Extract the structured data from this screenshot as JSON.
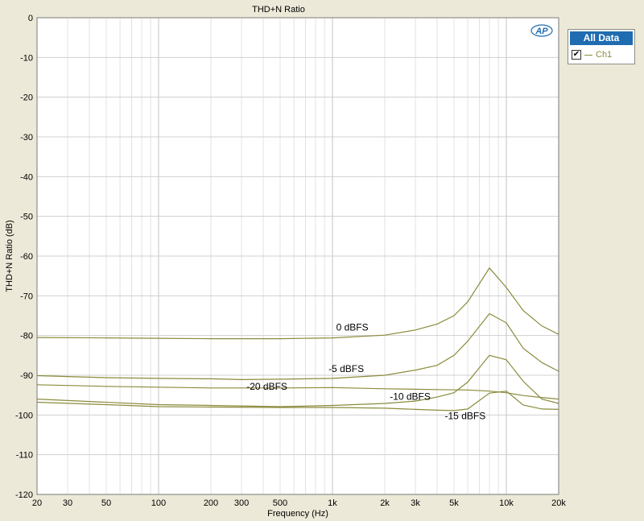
{
  "chart_data": {
    "type": "line",
    "title": "THD+N Ratio",
    "xlabel": "Frequency (Hz)",
    "ylabel": "THD+N Ratio (dB)",
    "xscale": "log",
    "xlim": [
      20,
      20000
    ],
    "ylim": [
      -120,
      0
    ],
    "xticks": [
      20,
      30,
      50,
      100,
      200,
      300,
      500,
      1000,
      2000,
      3000,
      5000,
      10000,
      20000
    ],
    "xtick_labels": [
      "20",
      "30",
      "50",
      "100",
      "200",
      "300",
      "500",
      "1k",
      "2k",
      "3k",
      "5k",
      "10k",
      "20k"
    ],
    "yticks": [
      0,
      -10,
      -20,
      -30,
      -40,
      -50,
      -60,
      -70,
      -80,
      -90,
      -100,
      -110,
      -120
    ],
    "grid": true,
    "series_color": "#8b8b3c",
    "series": [
      {
        "label": "0 dBFS",
        "x": [
          20,
          50,
          100,
          200,
          500,
          1000,
          2000,
          3000,
          4000,
          5000,
          6000,
          8000,
          10000,
          12500,
          16000,
          20000
        ],
        "y": [
          -80.5,
          -80.6,
          -80.7,
          -80.8,
          -80.8,
          -80.6,
          -79.9,
          -78.6,
          -77.1,
          -75.0,
          -71.5,
          -63.0,
          -67.9,
          -73.7,
          -77.6,
          -79.7
        ]
      },
      {
        "label": "-5 dBFS",
        "x": [
          20,
          50,
          100,
          200,
          300,
          500,
          1000,
          2000,
          3000,
          4000,
          5000,
          6000,
          8000,
          10000,
          12500,
          16000,
          20000
        ],
        "y": [
          -90.1,
          -90.6,
          -90.8,
          -90.9,
          -91.1,
          -91.0,
          -90.8,
          -90.0,
          -88.7,
          -87.5,
          -85.0,
          -81.4,
          -74.5,
          -76.8,
          -83.2,
          -86.8,
          -89.0
        ]
      },
      {
        "label": "-10 dBFS",
        "x": [
          20,
          100,
          200,
          500,
          1000,
          2000,
          3000,
          4000,
          5000,
          6000,
          8000,
          10000,
          12500,
          16000,
          20000
        ],
        "y": [
          -96.0,
          -97.4,
          -97.6,
          -97.9,
          -97.6,
          -97.1,
          -96.5,
          -95.5,
          -94.4,
          -91.7,
          -85.0,
          -86.1,
          -91.5,
          -96.0,
          -97.1
        ]
      },
      {
        "label": "-15 dBFS",
        "x": [
          20,
          50,
          100,
          200,
          500,
          1000,
          2000,
          3000,
          4000,
          5000,
          6000,
          8000,
          10000,
          12500,
          16000,
          20000
        ],
        "y": [
          -96.8,
          -97.4,
          -97.9,
          -98.0,
          -98.1,
          -98.1,
          -98.3,
          -98.6,
          -98.8,
          -98.9,
          -98.5,
          -94.5,
          -94.0,
          -97.5,
          -98.5,
          -98.6
        ]
      },
      {
        "label": "-20 dBFS",
        "x": [
          20,
          50,
          100,
          200,
          500,
          1000,
          2000,
          4000,
          6000,
          8000,
          10000,
          12500,
          16000,
          20000
        ],
        "y": [
          -92.4,
          -92.8,
          -93.0,
          -93.2,
          -93.2,
          -93.1,
          -93.4,
          -93.6,
          -93.7,
          -94.0,
          -94.4,
          -95.1,
          -95.6,
          -96.0
        ]
      }
    ],
    "annotations": [
      {
        "text": "0 dBFS",
        "x": 1300,
        "y": -78.8
      },
      {
        "text": "-5 dBFS",
        "x": 1200,
        "y": -89.2
      },
      {
        "text": "-20 dBFS",
        "x": 420,
        "y": -93.6
      },
      {
        "text": "-10 dBFS",
        "x": 2800,
        "y": -96.2
      },
      {
        "text": "-15 dBFS",
        "x": 5800,
        "y": -101.0
      }
    ]
  },
  "legend": {
    "header": "All Data",
    "item_label": "Ch1",
    "checked": "✔"
  },
  "logo_text": "AP"
}
